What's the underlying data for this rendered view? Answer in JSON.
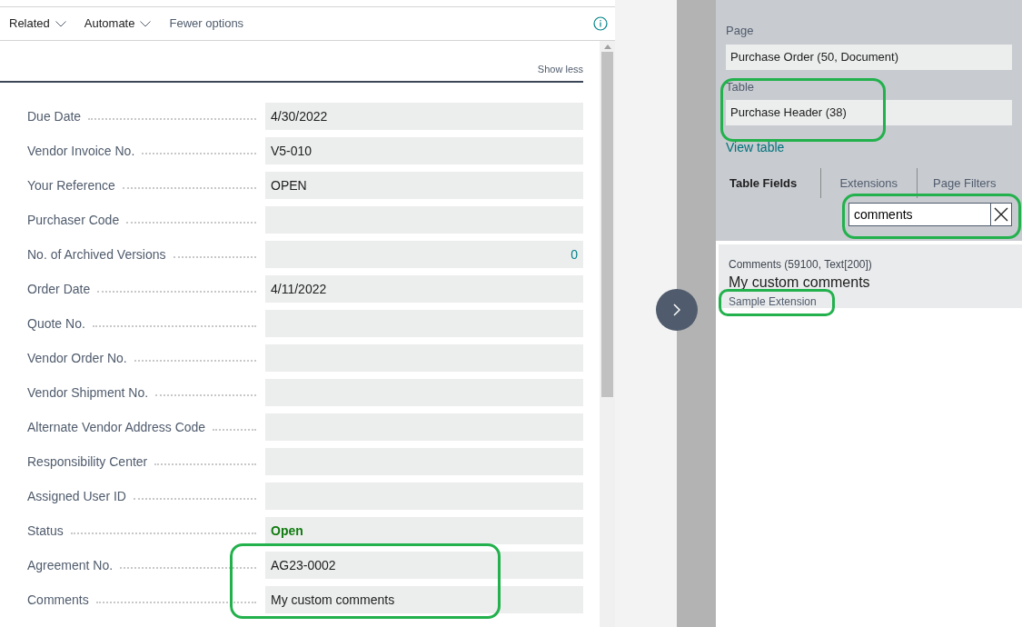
{
  "toolbar": {
    "menus": [
      {
        "label": "Related"
      },
      {
        "label": "Automate"
      }
    ],
    "link": "Fewer options"
  },
  "show_less": "Show less",
  "fields": [
    {
      "label": "Due Date",
      "value": "4/30/2022",
      "kind": "text"
    },
    {
      "label": "Vendor Invoice No.",
      "value": "V5-010",
      "kind": "text"
    },
    {
      "label": "Your Reference",
      "value": "OPEN",
      "kind": "text"
    },
    {
      "label": "Purchaser Code",
      "kind": "text"
    },
    {
      "label": "No. of Archived Versions",
      "value": "0",
      "kind": "number"
    },
    {
      "label": "Order Date",
      "value": "4/11/2022",
      "kind": "text"
    },
    {
      "label": "Quote No.",
      "kind": "text"
    },
    {
      "label": "Vendor Order No.",
      "kind": "text"
    },
    {
      "label": "Vendor Shipment No.",
      "kind": "text"
    },
    {
      "label": "Alternate Vendor Address Code",
      "kind": "text"
    },
    {
      "label": "Responsibility Center",
      "kind": "text"
    },
    {
      "label": "Assigned User ID",
      "kind": "text"
    },
    {
      "label": "Status",
      "value": "Open",
      "kind": "status"
    },
    {
      "label": "Agreement No.",
      "value": "AG23-0002",
      "kind": "text"
    },
    {
      "label": "Comments",
      "value": "My custom comments",
      "kind": "text"
    }
  ],
  "inspector": {
    "page_label": "Page",
    "page_value": "Purchase Order (50, Document)",
    "table_label": "Table",
    "table_value": "Purchase Header (38)",
    "view_table": "View table",
    "tabs": [
      {
        "label": "Table Fields",
        "selected": true
      },
      {
        "label": "Extensions",
        "selected": false
      },
      {
        "label": "Page Filters",
        "selected": false
      }
    ],
    "search": {
      "value": "comments"
    },
    "result": {
      "field": "Comments (59100, Text[200])",
      "value": "My custom comments",
      "extension": "Sample Extension"
    }
  }
}
